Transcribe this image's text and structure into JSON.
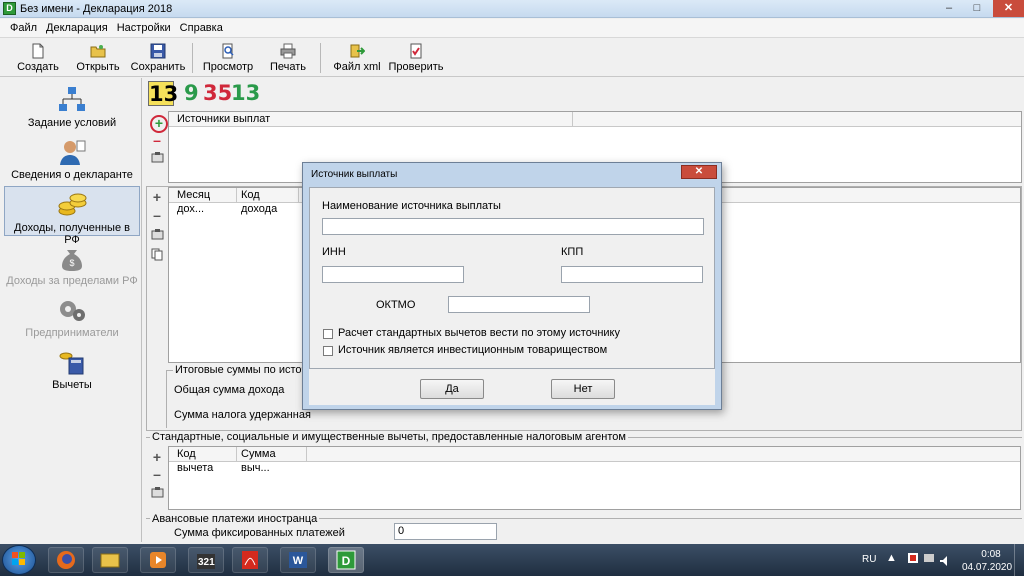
{
  "window": {
    "title": "Без имени - Декларация 2018",
    "controls": {
      "minimize": "–",
      "maximize": "□",
      "close": "✕"
    }
  },
  "menu": [
    "Файл",
    "Декларация",
    "Настройки",
    "Справка"
  ],
  "toolbar": {
    "create": "Создать",
    "open": "Открыть",
    "save": "Сохранить",
    "preview": "Просмотр",
    "print": "Печать",
    "xml": "Файл xml",
    "check": "Проверить"
  },
  "nav": [
    {
      "label": "Задание условий"
    },
    {
      "label": "Сведения о декларанте"
    },
    {
      "label": "Доходы, полученные в РФ"
    },
    {
      "label": "Доходы за пределами РФ"
    },
    {
      "label": "Предприниматели"
    },
    {
      "label": "Вычеты"
    }
  ],
  "counters": [
    {
      "text": "13",
      "color": "#1a1a1a",
      "bg": "#f5e15a"
    },
    {
      "text": "9",
      "color": "#2a9a4a"
    },
    {
      "text": "35",
      "color": "#d0283a"
    },
    {
      "text": "13",
      "color": "#2a9a4a"
    }
  ],
  "sources_panel": {
    "header": "Источники выплат"
  },
  "income_panel": {
    "columns": [
      "Месяц дох...",
      "Код дохода"
    ]
  },
  "totals": {
    "title": "Итоговые суммы по источ",
    "total_income": "Общая сумма дохода",
    "tax_withheld": "Сумма налога удержанная"
  },
  "deductions_panel": {
    "title": "Стандартные, социальные и имущественные вычеты, предоставленные налоговым агентом",
    "columns": [
      "Код вычета",
      "Сумма выч..."
    ]
  },
  "advance": {
    "title": "Авансовые платежи иностранца",
    "fixed_label": "Сумма фиксированных платежей",
    "fixed_value": "0"
  },
  "dialog": {
    "title": "Источник выплаты",
    "name_label": "Наименование источника выплаты",
    "name_value": "",
    "inn_label": "ИНН",
    "inn_value": "",
    "kpp_label": "КПП",
    "kpp_value": "",
    "oktmo_label": "ОКТМО",
    "oktmo_value": "",
    "check_standard": "Расчет стандартных вычетов вести по этому источнику",
    "check_invest": "Источник является инвестиционным товариществом",
    "yes": "Да",
    "no": "Нет"
  },
  "taskbar": {
    "lang": "RU",
    "time": "0:08",
    "date": "04.07.2020",
    "media_label": "321"
  }
}
